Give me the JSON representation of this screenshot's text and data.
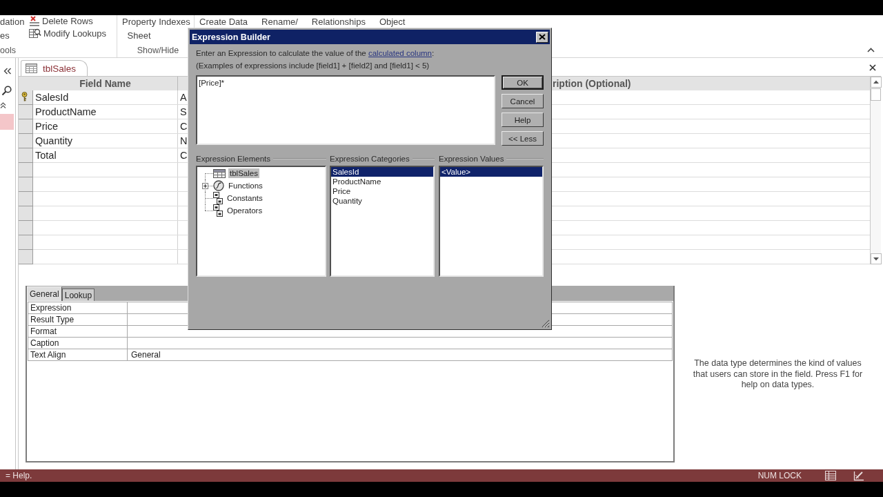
{
  "ribbon": {
    "groups": [
      {
        "label": "ools",
        "buttons": [
          {
            "kind": "large",
            "lines": [
              "dation",
              "es"
            ]
          },
          {
            "kind": "delete",
            "label": "Delete Rows"
          },
          {
            "kind": "lookup",
            "label": "Modify Lookups"
          }
        ]
      },
      {
        "label": "Show/Hide",
        "buttons": [
          {
            "kind": "large",
            "lines": [
              "Property",
              "Sheet"
            ]
          },
          {
            "kind": "large",
            "lines": [
              "Indexes"
            ]
          }
        ]
      },
      {
        "buttons": [
          {
            "kind": "large",
            "lines": [
              "Create Data"
            ]
          },
          {
            "kind": "large",
            "lines": [
              "Rename/"
            ]
          },
          {
            "kind": "large",
            "lines": [
              "Relationships"
            ]
          },
          {
            "kind": "large",
            "lines": [
              "Object"
            ]
          }
        ]
      }
    ]
  },
  "nav_pane": {
    "items": [
      {
        "selected": true
      }
    ]
  },
  "document_tabs": [
    {
      "label": "tblSales",
      "selected": true
    }
  ],
  "design_grid": {
    "headers": {
      "column_1": "Field Name",
      "column_3": "ription (Optional)"
    },
    "rows": [
      {
        "field_name": "SalesId",
        "column_2": "A",
        "primary_key": true
      },
      {
        "field_name": "ProductName",
        "column_2": "S",
        "primary_key": false
      },
      {
        "field_name": "Price",
        "column_2": "C",
        "primary_key": false
      },
      {
        "field_name": "Quantity",
        "column_2": "N",
        "primary_key": false
      },
      {
        "field_name": "Total",
        "column_2": "C",
        "primary_key": false
      }
    ]
  },
  "property_sheet": {
    "tabs": [
      {
        "label": "General",
        "selected": true
      },
      {
        "label": "Lookup",
        "selected": false
      }
    ],
    "rows": [
      {
        "name": "Expression"
      },
      {
        "name": "Result Type"
      },
      {
        "name": "Format"
      },
      {
        "name": "Caption"
      },
      {
        "name": "Text Align",
        "value": "General"
      }
    ],
    "help_text": "The data type determines the kind of values that users can store in the field. Press F1 for help on data types."
  },
  "dialog": {
    "title": "Expression Builder",
    "prompt": {
      "before": "Enter an Expression to calculate the value of the ",
      "link": "calculated column",
      "after": ":"
    },
    "examples": "(Examples of expressions include [field1] + [field2] and [field1] < 5)",
    "expression": "[Price]*",
    "buttons": [
      {
        "label": "OK",
        "default": true
      },
      {
        "label": "Cancel",
        "default": false
      },
      {
        "label": "Help",
        "default": false
      },
      {
        "label": "<< Less",
        "default": false
      }
    ],
    "elements": {
      "label": "Expression Elements",
      "items": [
        {
          "label": "tblSales",
          "kind": "table",
          "expandable": false,
          "selected": true
        },
        {
          "label": "Functions",
          "kind": "function",
          "expandable": true,
          "selected": false
        },
        {
          "label": "Constants",
          "kind": "constant",
          "expandable": false,
          "selected": false
        },
        {
          "label": "Operators",
          "kind": "operator",
          "expandable": false,
          "selected": false
        }
      ]
    },
    "categories": {
      "label": "Expression Categories",
      "items": [
        {
          "label": "SalesId",
          "selected": true
        },
        {
          "label": "ProductName",
          "selected": false
        },
        {
          "label": "Price",
          "selected": false
        },
        {
          "label": "Quantity",
          "selected": false
        }
      ]
    },
    "values": {
      "label": "Expression Values",
      "items": [
        {
          "label": "<Value>",
          "selected": true
        }
      ]
    }
  },
  "status_bar": {
    "message": "= Help.",
    "indicators": [
      "NUM LOCK"
    ]
  }
}
